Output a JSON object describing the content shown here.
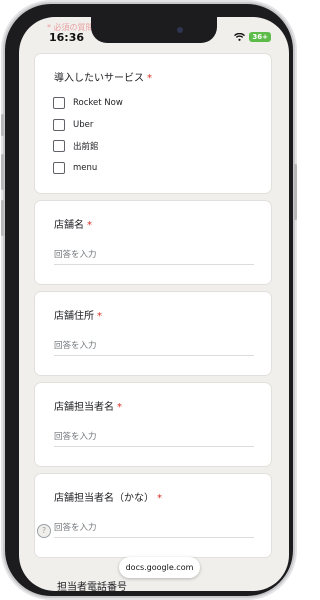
{
  "status": {
    "time": "16:36",
    "battery": "36+"
  },
  "peek_top": "* 必須の質問",
  "cards": [
    {
      "title": "導入したいサービス",
      "required": "*",
      "options": [
        "Rocket Now",
        "Uber",
        "出前館",
        "menu"
      ]
    },
    {
      "title": "店舗名",
      "required": "*",
      "placeholder": "回答を入力"
    },
    {
      "title": "店舗住所",
      "required": "*",
      "placeholder": "回答を入力"
    },
    {
      "title": "店舗担当者名",
      "required": "*",
      "placeholder": "回答を入力"
    },
    {
      "title": "店舗担当者名（かな）",
      "required": "*",
      "placeholder": "回答を入力"
    }
  ],
  "peek_bottom": "担当者電話番号",
  "url": "docs.google.com",
  "help_label": "?",
  "colors": {
    "required": "#d93025",
    "background": "#f1efec"
  }
}
